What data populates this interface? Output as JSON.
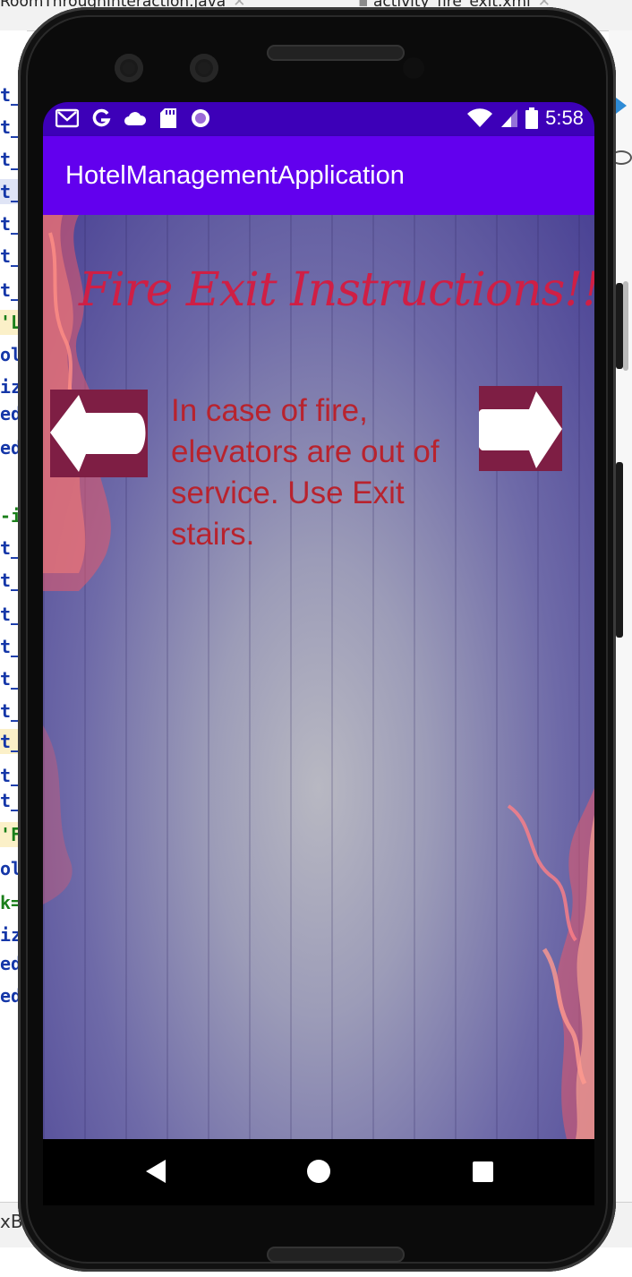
{
  "ide": {
    "tab_left": "RoomThroughInteraction.java",
    "tab_right": "activity_fire_exit.xml",
    "bottom_text": "xB",
    "code_fragments": [
      "t_",
      "t_",
      "t_",
      "t_",
      "t_",
      "t_",
      "t_",
      "'L",
      "ol",
      "iz",
      "ed",
      "ed",
      "-i",
      "t_",
      "t_",
      "t_",
      "t_",
      "t_",
      "t_",
      "t_",
      "t_",
      "t_",
      "'F",
      "ol",
      "k=",
      "iz",
      "ed",
      "ed"
    ]
  },
  "status_bar": {
    "time": "5:58",
    "left_icons": [
      "gmail-icon",
      "google-icon",
      "cloud-icon",
      "sd-card-icon",
      "circle-icon"
    ],
    "right_icons": [
      "wifi-icon",
      "signal-icon",
      "battery-icon"
    ]
  },
  "app_bar": {
    "title": "HotelManagementApplication"
  },
  "main": {
    "title": "Fire Exit Instructions!!",
    "instruction": "In case of fire, elevators are out of service. Use Exit stairs.",
    "prev_icon": "left-arrow-icon",
    "next_icon": "right-arrow-icon"
  },
  "nav_bar": {
    "items": [
      "back-icon",
      "home-icon",
      "recents-icon"
    ]
  },
  "colors": {
    "status_bar": "#3d00b8",
    "app_bar": "#6200ee",
    "title_text": "#cf1f45",
    "instruction_text": "#b8232e",
    "arrow_bg": "#7e1e44"
  }
}
